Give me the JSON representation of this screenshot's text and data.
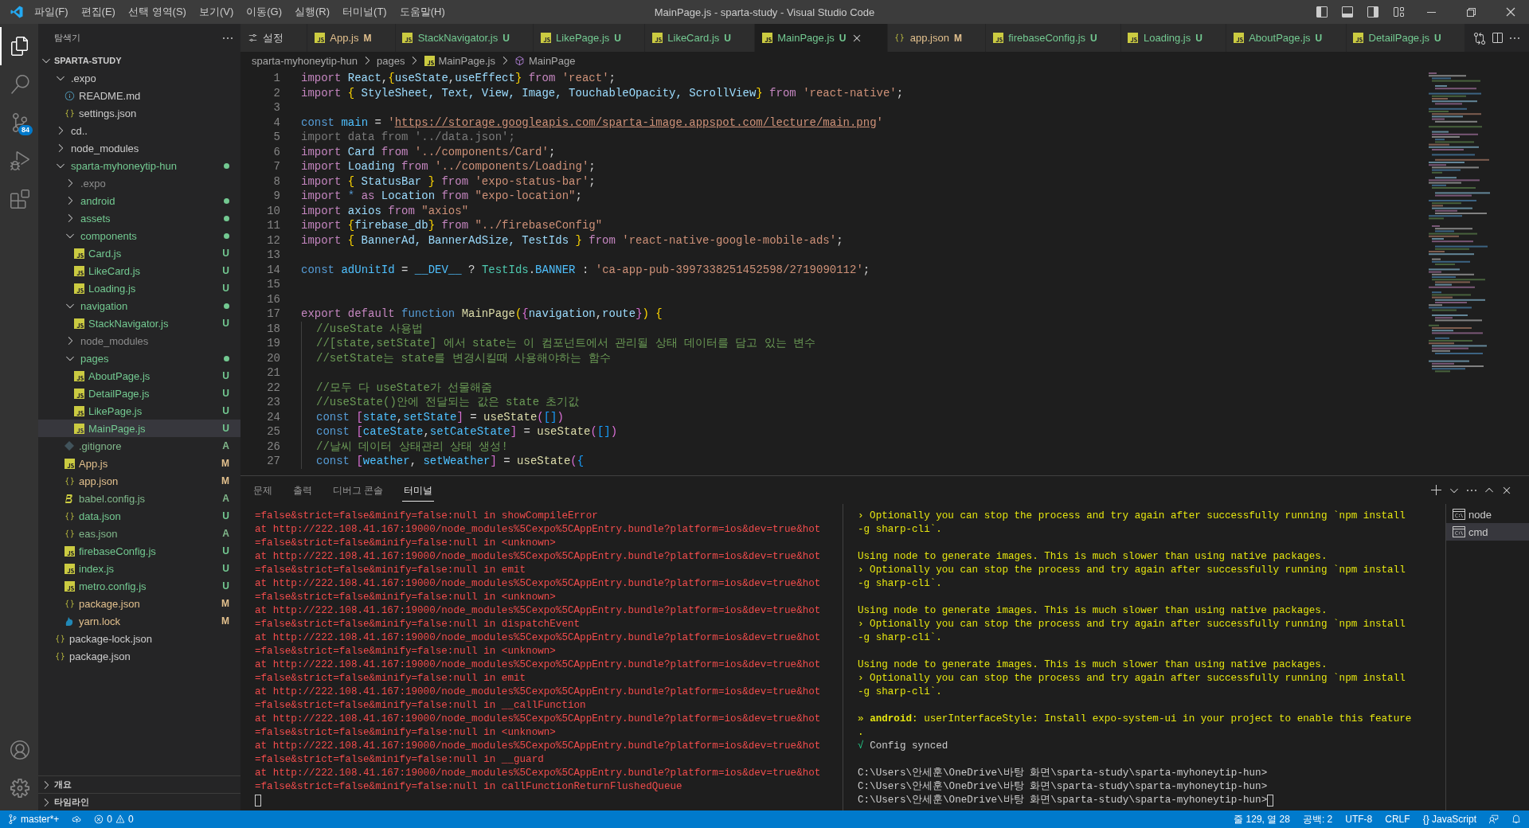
{
  "title_bar": {
    "menus": [
      "파일(F)",
      "편집(E)",
      "선택 영역(S)",
      "보기(V)",
      "이동(G)",
      "실행(R)",
      "터미널(T)",
      "도움말(H)"
    ],
    "title": "MainPage.js - sparta-study - Visual Studio Code"
  },
  "activity_bar": {
    "items": [
      {
        "kind": "explorer",
        "selected": true
      },
      {
        "kind": "search",
        "selected": false
      },
      {
        "kind": "source_control",
        "selected": false,
        "badge": "84"
      },
      {
        "kind": "run",
        "selected": false
      },
      {
        "kind": "extensions",
        "selected": false
      }
    ],
    "bottom": [
      {
        "kind": "account"
      },
      {
        "kind": "manage"
      }
    ]
  },
  "explorer": {
    "title": "탐색기",
    "root": {
      "label": "SPARTA-STUDY",
      "expanded": true
    },
    "tree": [
      {
        "name": ".expo",
        "kind": "folder",
        "expanded": true,
        "selected": false,
        "children": [
          {
            "name": "README.md",
            "kind": "info",
            "selected": false
          },
          {
            "name": "settings.json",
            "kind": "json",
            "selected": false
          }
        ]
      },
      {
        "name": "cd..",
        "kind": "folder",
        "expanded": false,
        "selected": false
      },
      {
        "name": "node_modules",
        "kind": "folder",
        "expanded": false,
        "selected": false
      },
      {
        "name": "sparta-myhoneytip-hun",
        "kind": "folder",
        "expanded": true,
        "selected": false,
        "color": "#73c991",
        "dot": true,
        "children": [
          {
            "name": ".expo",
            "kind": "folder",
            "expanded": false,
            "selected": false,
            "dim": true
          },
          {
            "name": "android",
            "kind": "folder",
            "expanded": false,
            "selected": false,
            "color": "#73c991",
            "dot": true
          },
          {
            "name": "assets",
            "kind": "folder",
            "expanded": false,
            "selected": false,
            "color": "#73c991",
            "dot": true
          },
          {
            "name": "components",
            "kind": "folder",
            "expanded": true,
            "selected": false,
            "color": "#73c991",
            "dot": true,
            "children": [
              {
                "name": "Card.js",
                "kind": "js",
                "selected": false,
                "color": "#73c991",
                "badge": "U"
              },
              {
                "name": "LikeCard.js",
                "kind": "js",
                "selected": false,
                "color": "#73c991",
                "badge": "U"
              },
              {
                "name": "Loading.js",
                "kind": "js",
                "selected": false,
                "color": "#73c991",
                "badge": "U"
              }
            ]
          },
          {
            "name": "navigation",
            "kind": "folder",
            "expanded": true,
            "selected": false,
            "color": "#73c991",
            "dot": true,
            "children": [
              {
                "name": "StackNavigator.js",
                "kind": "js",
                "selected": false,
                "color": "#73c991",
                "badge": "U"
              }
            ]
          },
          {
            "name": "node_modules",
            "kind": "folder",
            "expanded": false,
            "selected": false,
            "dim": true
          },
          {
            "name": "pages",
            "kind": "folder",
            "expanded": true,
            "selected": false,
            "color": "#73c991",
            "dot": true,
            "children": [
              {
                "name": "AboutPage.js",
                "kind": "js",
                "selected": false,
                "color": "#73c991",
                "badge": "U"
              },
              {
                "name": "DetailPage.js",
                "kind": "js",
                "selected": false,
                "color": "#73c991",
                "badge": "U"
              },
              {
                "name": "LikePage.js",
                "kind": "js",
                "selected": false,
                "color": "#73c991",
                "badge": "U"
              },
              {
                "name": "MainPage.js",
                "kind": "js",
                "selected": true,
                "color": "#73c991",
                "badge": "U"
              }
            ]
          },
          {
            "name": ".gitignore",
            "kind": "git",
            "selected": false,
            "color": "#81b88b",
            "badge": "A"
          },
          {
            "name": "App.js",
            "kind": "js",
            "selected": false,
            "color": "#e2c08d",
            "badge": "M"
          },
          {
            "name": "app.json",
            "kind": "json",
            "selected": false,
            "color": "#e2c08d",
            "badge": "M"
          },
          {
            "name": "babel.config.js",
            "kind": "babel",
            "selected": false,
            "color": "#81b88b",
            "badge": "A"
          },
          {
            "name": "data.json",
            "kind": "json",
            "selected": false,
            "color": "#73c991",
            "badge": "U"
          },
          {
            "name": "eas.json",
            "kind": "json",
            "selected": false,
            "color": "#81b88b",
            "badge": "A"
          },
          {
            "name": "firebaseConfig.js",
            "kind": "js",
            "selected": false,
            "color": "#73c991",
            "badge": "U"
          },
          {
            "name": "index.js",
            "kind": "js",
            "selected": false,
            "color": "#73c991",
            "badge": "U"
          },
          {
            "name": "metro.config.js",
            "kind": "js",
            "selected": false,
            "color": "#73c991",
            "badge": "U"
          },
          {
            "name": "package.json",
            "kind": "json",
            "selected": false,
            "color": "#e2c08d",
            "badge": "M"
          },
          {
            "name": "yarn.lock",
            "kind": "yarn",
            "selected": false,
            "color": "#e2c08d",
            "badge": "M"
          }
        ]
      },
      {
        "name": "package-lock.json",
        "kind": "json",
        "selected": false
      },
      {
        "name": "package.json",
        "kind": "json",
        "selected": false
      }
    ],
    "sections": [
      {
        "label": "개요",
        "expanded": false
      },
      {
        "label": "타임라인",
        "expanded": false
      }
    ]
  },
  "tabs": [
    {
      "label": "설정",
      "kind": "settings",
      "selected": false
    },
    {
      "label": "App.js",
      "kind": "js",
      "badge": "M",
      "color": "#e2c08d",
      "selected": false
    },
    {
      "label": "StackNavigator.js",
      "kind": "js",
      "badge": "U",
      "color": "#73c991",
      "selected": false
    },
    {
      "label": "LikePage.js",
      "kind": "js",
      "badge": "U",
      "color": "#73c991",
      "selected": false
    },
    {
      "label": "LikeCard.js",
      "kind": "js",
      "badge": "U",
      "color": "#73c991",
      "selected": false
    },
    {
      "label": "MainPage.js",
      "kind": "js",
      "badge": "U",
      "color": "#73c991",
      "selected": true
    },
    {
      "label": "app.json",
      "kind": "json",
      "badge": "M",
      "color": "#e2c08d",
      "selected": false
    },
    {
      "label": "firebaseConfig.js",
      "kind": "js",
      "badge": "U",
      "color": "#73c991",
      "selected": false
    },
    {
      "label": "Loading.js",
      "kind": "js",
      "badge": "U",
      "color": "#73c991",
      "selected": false
    },
    {
      "label": "AboutPage.js",
      "kind": "js",
      "badge": "U",
      "color": "#73c991",
      "selected": false
    },
    {
      "label": "DetailPage.js",
      "kind": "js",
      "badge": "U",
      "color": "#73c991",
      "selected": false
    }
  ],
  "breadcrumb": [
    {
      "label": "sparta-myhoneytip-hun",
      "kind": "folder"
    },
    {
      "label": "pages",
      "kind": "folder"
    },
    {
      "label": "MainPage.js",
      "kind": "js"
    },
    {
      "label": "MainPage",
      "kind": "symbol"
    }
  ],
  "editor": {
    "lines": [
      {
        "n": "1",
        "tokens": [
          {
            "kind": "kw",
            "text": "import "
          },
          {
            "kind": "var",
            "text": "React"
          },
          {
            "kind": "p",
            "text": ","
          },
          {
            "kind": "br",
            "text": "{"
          },
          {
            "kind": "var",
            "text": "useState"
          },
          {
            "kind": "p",
            "text": ","
          },
          {
            "kind": "var",
            "text": "useEffect"
          },
          {
            "kind": "br",
            "text": "}"
          },
          {
            "kind": "kw",
            "text": " from "
          },
          {
            "kind": "str",
            "text": "'react'"
          },
          {
            "kind": "p",
            "text": ";"
          }
        ]
      },
      {
        "n": "2",
        "tokens": [
          {
            "kind": "kw",
            "text": "import "
          },
          {
            "kind": "br",
            "text": "{"
          },
          {
            "kind": "var",
            "text": " StyleSheet, Text, View, Image, TouchableOpacity, ScrollView"
          },
          {
            "kind": "br",
            "text": "}"
          },
          {
            "kind": "kw",
            "text": " from "
          },
          {
            "kind": "str",
            "text": "'react-native'"
          },
          {
            "kind": "p",
            "text": ";"
          }
        ]
      },
      {
        "n": "3"
      },
      {
        "n": "4",
        "tokens": [
          {
            "kind": "decl",
            "text": "const "
          },
          {
            "kind": "cst",
            "text": "main"
          },
          {
            "kind": "p",
            "text": " = "
          },
          {
            "kind": "str",
            "text": "'"
          },
          {
            "kind": "link",
            "text": "https://storage.googleapis.com/sparta-image.appspot.com/lecture/main.png"
          },
          {
            "kind": "str",
            "text": "'"
          }
        ]
      },
      {
        "n": "5",
        "tokens": [
          {
            "kind": "dim",
            "text": "import data from '../data.json';"
          }
        ]
      },
      {
        "n": "6",
        "tokens": [
          {
            "kind": "kw",
            "text": "import "
          },
          {
            "kind": "var",
            "text": "Card"
          },
          {
            "kind": "kw",
            "text": " from "
          },
          {
            "kind": "str",
            "text": "'../components/Card'"
          },
          {
            "kind": "p",
            "text": ";"
          }
        ]
      },
      {
        "n": "7",
        "tokens": [
          {
            "kind": "kw",
            "text": "import "
          },
          {
            "kind": "var",
            "text": "Loading"
          },
          {
            "kind": "kw",
            "text": " from "
          },
          {
            "kind": "str",
            "text": "'../components/Loading'"
          },
          {
            "kind": "p",
            "text": ";"
          }
        ]
      },
      {
        "n": "8",
        "tokens": [
          {
            "kind": "kw",
            "text": "import "
          },
          {
            "kind": "br",
            "text": "{"
          },
          {
            "kind": "var",
            "text": " StatusBar "
          },
          {
            "kind": "br",
            "text": "}"
          },
          {
            "kind": "kw",
            "text": " from "
          },
          {
            "kind": "str",
            "text": "'expo-status-bar'"
          },
          {
            "kind": "p",
            "text": ";"
          }
        ]
      },
      {
        "n": "9",
        "tokens": [
          {
            "kind": "kw",
            "text": "import "
          },
          {
            "kind": "decl",
            "text": "* "
          },
          {
            "kind": "kw",
            "text": "as "
          },
          {
            "kind": "var",
            "text": "Location"
          },
          {
            "kind": "kw",
            "text": " from "
          },
          {
            "kind": "str",
            "text": "\"expo-location\""
          },
          {
            "kind": "p",
            "text": ";"
          }
        ]
      },
      {
        "n": "10",
        "tokens": [
          {
            "kind": "kw",
            "text": "import "
          },
          {
            "kind": "var",
            "text": "axios"
          },
          {
            "kind": "kw",
            "text": " from "
          },
          {
            "kind": "str",
            "text": "\"axios\""
          }
        ]
      },
      {
        "n": "11",
        "tokens": [
          {
            "kind": "kw",
            "text": "import "
          },
          {
            "kind": "br",
            "text": "{"
          },
          {
            "kind": "var",
            "text": "firebase_db"
          },
          {
            "kind": "br",
            "text": "}"
          },
          {
            "kind": "kw",
            "text": " from "
          },
          {
            "kind": "str",
            "text": "\"../firebaseConfig\""
          }
        ]
      },
      {
        "n": "12",
        "tokens": [
          {
            "kind": "kw",
            "text": "import "
          },
          {
            "kind": "br",
            "text": "{"
          },
          {
            "kind": "var",
            "text": " BannerAd, BannerAdSize, TestIds "
          },
          {
            "kind": "br",
            "text": "}"
          },
          {
            "kind": "kw",
            "text": " from "
          },
          {
            "kind": "str",
            "text": "'react-native-google-mobile-ads'"
          },
          {
            "kind": "p",
            "text": ";"
          }
        ]
      },
      {
        "n": "13"
      },
      {
        "n": "14",
        "tokens": [
          {
            "kind": "decl",
            "text": "const "
          },
          {
            "kind": "cst",
            "text": "adUnitId"
          },
          {
            "kind": "p",
            "text": " = "
          },
          {
            "kind": "cst",
            "text": "__DEV__"
          },
          {
            "kind": "p",
            "text": " ? "
          },
          {
            "kind": "cls",
            "text": "TestIds"
          },
          {
            "kind": "p",
            "text": "."
          },
          {
            "kind": "cst",
            "text": "BANNER"
          },
          {
            "kind": "p",
            "text": " : "
          },
          {
            "kind": "str",
            "text": "'ca-app-pub-3997338251452598/2719090112'"
          },
          {
            "kind": "p",
            "text": ";"
          }
        ]
      },
      {
        "n": "15"
      },
      {
        "n": "16"
      },
      {
        "n": "17",
        "tokens": [
          {
            "kind": "kw",
            "text": "export default "
          },
          {
            "kind": "decl",
            "text": "function "
          },
          {
            "kind": "fn",
            "text": "MainPage"
          },
          {
            "kind": "br",
            "text": "("
          },
          {
            "kind": "br2",
            "text": "{"
          },
          {
            "kind": "var",
            "text": "navigation"
          },
          {
            "kind": "p",
            "text": ","
          },
          {
            "kind": "var",
            "text": "route"
          },
          {
            "kind": "br2",
            "text": "}"
          },
          {
            "kind": "br",
            "text": ")"
          },
          {
            "kind": "br",
            "text": " {"
          }
        ]
      },
      {
        "n": "18",
        "indent": true,
        "tokens": [
          {
            "kind": "cmt",
            "text": "//useState 사용법"
          }
        ]
      },
      {
        "n": "19",
        "indent": true,
        "tokens": [
          {
            "kind": "cmt",
            "text": "//[state,setState] 에서 state는 이 컴포넌트에서 관리될 상태 데이터를 담고 있는 변수"
          }
        ]
      },
      {
        "n": "20",
        "indent": true,
        "tokens": [
          {
            "kind": "cmt",
            "text": "//setState는 state를 변경시킬때 사용해야하는 함수"
          }
        ]
      },
      {
        "n": "21",
        "indent": true
      },
      {
        "n": "22",
        "indent": true,
        "tokens": [
          {
            "kind": "cmt",
            "text": "//모두 다 useState가 선물해줌"
          }
        ]
      },
      {
        "n": "23",
        "indent": true,
        "tokens": [
          {
            "kind": "cmt",
            "text": "//useState()안에 전달되는 값은 state 초기값"
          }
        ]
      },
      {
        "n": "24",
        "indent": true,
        "tokens": [
          {
            "kind": "decl",
            "text": "const "
          },
          {
            "kind": "br2",
            "text": "["
          },
          {
            "kind": "cst",
            "text": "state"
          },
          {
            "kind": "p",
            "text": ","
          },
          {
            "kind": "cst",
            "text": "setState"
          },
          {
            "kind": "br2",
            "text": "]"
          },
          {
            "kind": "p",
            "text": " = "
          },
          {
            "kind": "fn",
            "text": "useState"
          },
          {
            "kind": "br2",
            "text": "("
          },
          {
            "kind": "br3",
            "text": "[]"
          },
          {
            "kind": "br2",
            "text": ")"
          }
        ]
      },
      {
        "n": "25",
        "indent": true,
        "tokens": [
          {
            "kind": "decl",
            "text": "const "
          },
          {
            "kind": "br2",
            "text": "["
          },
          {
            "kind": "cst",
            "text": "cateState"
          },
          {
            "kind": "p",
            "text": ","
          },
          {
            "kind": "cst",
            "text": "setCateState"
          },
          {
            "kind": "br2",
            "text": "]"
          },
          {
            "kind": "p",
            "text": " = "
          },
          {
            "kind": "fn",
            "text": "useState"
          },
          {
            "kind": "br2",
            "text": "("
          },
          {
            "kind": "br3",
            "text": "[]"
          },
          {
            "kind": "br2",
            "text": ")"
          }
        ]
      },
      {
        "n": "26",
        "indent": true,
        "tokens": [
          {
            "kind": "cmt",
            "text": "//날씨 데이터 상태관리 상태 생성!"
          }
        ]
      },
      {
        "n": "27",
        "indent": true,
        "tokens": [
          {
            "kind": "decl",
            "text": "const "
          },
          {
            "kind": "br2",
            "text": "["
          },
          {
            "kind": "cst",
            "text": "weather"
          },
          {
            "kind": "p",
            "text": ", "
          },
          {
            "kind": "cst",
            "text": "setWeather"
          },
          {
            "kind": "br2",
            "text": "]"
          },
          {
            "kind": "p",
            "text": " = "
          },
          {
            "kind": "fn",
            "text": "useState"
          },
          {
            "kind": "br2",
            "text": "("
          },
          {
            "kind": "br3",
            "text": "{"
          }
        ]
      }
    ]
  },
  "panel": {
    "tabs": [
      {
        "label": "문제",
        "selected": false
      },
      {
        "label": "출력",
        "selected": false
      },
      {
        "label": "디버그 콘솔",
        "selected": false
      },
      {
        "label": "터미널",
        "selected": true
      }
    ],
    "terminals": [
      {
        "label": "node",
        "selected": false
      },
      {
        "label": "cmd",
        "selected": true
      }
    ],
    "left": {
      "lines": [
        {
          "kind": "error",
          "text": "=false&strict=false&minify=false:null in showCompileError"
        },
        {
          "kind": "error",
          "text": "at http://222.108.41.167:19000/node_modules%5Cexpo%5CAppEntry.bundle?platform=ios&dev=true&hot"
        },
        {
          "kind": "error",
          "text": "=false&strict=false&minify=false:null in <unknown>"
        },
        {
          "kind": "error",
          "text": "at http://222.108.41.167:19000/node_modules%5Cexpo%5CAppEntry.bundle?platform=ios&dev=true&hot"
        },
        {
          "kind": "error",
          "text": "=false&strict=false&minify=false:null in emit"
        },
        {
          "kind": "error",
          "text": "at http://222.108.41.167:19000/node_modules%5Cexpo%5CAppEntry.bundle?platform=ios&dev=true&hot"
        },
        {
          "kind": "error",
          "text": "=false&strict=false&minify=false:null in <unknown>"
        },
        {
          "kind": "error",
          "text": "at http://222.108.41.167:19000/node_modules%5Cexpo%5CAppEntry.bundle?platform=ios&dev=true&hot"
        },
        {
          "kind": "error",
          "text": "=false&strict=false&minify=false:null in dispatchEvent"
        },
        {
          "kind": "error",
          "text": "at http://222.108.41.167:19000/node_modules%5Cexpo%5CAppEntry.bundle?platform=ios&dev=true&hot"
        },
        {
          "kind": "error",
          "text": "=false&strict=false&minify=false:null in <unknown>"
        },
        {
          "kind": "error",
          "text": "at http://222.108.41.167:19000/node_modules%5Cexpo%5CAppEntry.bundle?platform=ios&dev=true&hot"
        },
        {
          "kind": "error",
          "text": "=false&strict=false&minify=false:null in emit"
        },
        {
          "kind": "error",
          "text": "at http://222.108.41.167:19000/node_modules%5Cexpo%5CAppEntry.bundle?platform=ios&dev=true&hot"
        },
        {
          "kind": "error",
          "text": "=false&strict=false&minify=false:null in __callFunction"
        },
        {
          "kind": "error",
          "text": "at http://222.108.41.167:19000/node_modules%5Cexpo%5CAppEntry.bundle?platform=ios&dev=true&hot"
        },
        {
          "kind": "error",
          "text": "=false&strict=false&minify=false:null in <unknown>"
        },
        {
          "kind": "error",
          "text": "at http://222.108.41.167:19000/node_modules%5Cexpo%5CAppEntry.bundle?platform=ios&dev=true&hot"
        },
        {
          "kind": "error",
          "text": "=false&strict=false&minify=false:null in __guard"
        },
        {
          "kind": "error",
          "text": "at http://222.108.41.167:19000/node_modules%5Cexpo%5CAppEntry.bundle?platform=ios&dev=true&hot"
        },
        {
          "kind": "error",
          "text": "=false&strict=false&minify=false:null in callFunctionReturnFlushedQueue"
        },
        {
          "kind": "blank",
          "cursor": true
        }
      ]
    },
    "right": {
      "lines": [
        {
          "kind": "warn",
          "text": "› Optionally you can stop the process and try again after successfully running `npm install"
        },
        {
          "kind": "warn",
          "text": "-g sharp-cli`."
        },
        {
          "kind": "blank"
        },
        {
          "kind": "warn",
          "text": "Using node to generate images. This is much slower than using native packages."
        },
        {
          "kind": "warn",
          "text": "› Optionally you can stop the process and try again after successfully running `npm install"
        },
        {
          "kind": "warn",
          "text": "-g sharp-cli`."
        },
        {
          "kind": "blank"
        },
        {
          "kind": "warn",
          "text": "Using node to generate images. This is much slower than using native packages."
        },
        {
          "kind": "warn",
          "text": "› Optionally you can stop the process and try again after successfully running `npm install"
        },
        {
          "kind": "warn",
          "text": "-g sharp-cli`."
        },
        {
          "kind": "blank"
        },
        {
          "kind": "warn",
          "text": "Using node to generate images. This is much slower than using native packages."
        },
        {
          "kind": "warn",
          "text": "› Optionally you can stop the process and try again after successfully running `npm install"
        },
        {
          "kind": "warn",
          "text": "-g sharp-cli`."
        },
        {
          "kind": "blank"
        },
        {
          "kind": "warn",
          "text": "» **android**: userInterfaceStyle: Install expo-system-ui in your project to enable this feature"
        },
        {
          "kind": "warn",
          "text": "."
        },
        {
          "kind": "ok",
          "mark": "√",
          "text": "Config synced"
        },
        {
          "kind": "blank"
        },
        {
          "kind": "prompt",
          "text": "C:\\Users\\안세훈\\OneDrive\\바탕 화면\\sparta-study\\sparta-myhoneytip-hun>"
        },
        {
          "kind": "prompt",
          "text": "C:\\Users\\안세훈\\OneDrive\\바탕 화면\\sparta-study\\sparta-myhoneytip-hun>"
        },
        {
          "kind": "prompt",
          "text": "C:\\Users\\안세훈\\OneDrive\\바탕 화면\\sparta-study\\sparta-myhoneytip-hun>",
          "cursor": true
        }
      ]
    }
  },
  "status_bar": {
    "branch": "master*+",
    "errors": "0",
    "warnings": "0",
    "items": [
      "줄 129, 열 28",
      "공백: 2",
      "UTF-8",
      "CRLF",
      "{} JavaScript"
    ]
  }
}
